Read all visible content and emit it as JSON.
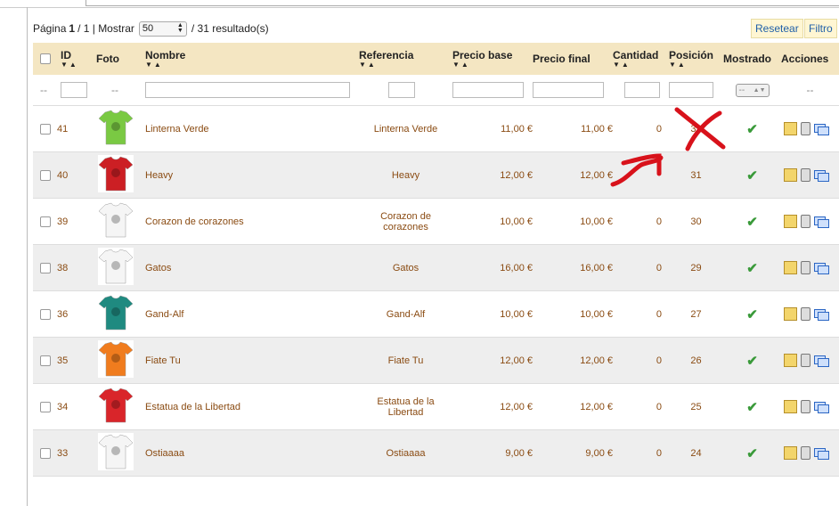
{
  "pager": {
    "page_label": "Página",
    "page_current": "1",
    "page_sep": "/ 1 | Mostrar",
    "per_page": "50",
    "results": "/ 31 resultado(s)"
  },
  "buttons": {
    "reset": "Resetear",
    "filter": "Filtro"
  },
  "columns": [
    "ID",
    "Foto",
    "Nombre",
    "Referencia",
    "Precio base",
    "Precio final",
    "Cantidad",
    "Posición",
    "Mostrado",
    "Acciones"
  ],
  "filter_row": {
    "dash": "--",
    "mostrado_value": "--"
  },
  "rows": [
    {
      "id": "41",
      "name": "Linterna Verde",
      "ref": "Linterna Verde",
      "base": "11,00 €",
      "final": "11,00 €",
      "qty": "0",
      "pos": "32",
      "shirt": "#7ac943",
      "shirt_icon": "lantern-shirt-icon"
    },
    {
      "id": "40",
      "name": "Heavy",
      "ref": "Heavy",
      "base": "12,00 €",
      "final": "12,00 €",
      "qty": "",
      "pos": "31",
      "shirt": "#cc1f24",
      "shirt_icon": "heavy-shirt-icon"
    },
    {
      "id": "39",
      "name": "Corazon de corazones",
      "ref": "Corazon de corazones",
      "base": "10,00 €",
      "final": "10,00 €",
      "qty": "0",
      "pos": "30",
      "shirt": "#f5f5f5",
      "shirt_icon": "heart-shirt-icon"
    },
    {
      "id": "38",
      "name": "Gatos",
      "ref": "Gatos",
      "base": "16,00 €",
      "final": "16,00 €",
      "qty": "0",
      "pos": "29",
      "shirt": "#f5f5f5",
      "shirt_icon": "cats-shirt-icon"
    },
    {
      "id": "36",
      "name": "Gand-Alf",
      "ref": "Gand-Alf",
      "base": "10,00 €",
      "final": "10,00 €",
      "qty": "0",
      "pos": "27",
      "shirt": "#1f8a80",
      "shirt_icon": "gandalf-shirt-icon"
    },
    {
      "id": "35",
      "name": "Fiate Tu",
      "ref": "Fiate Tu",
      "base": "12,00 €",
      "final": "12,00 €",
      "qty": "0",
      "pos": "26",
      "shirt": "#f07c1e",
      "shirt_icon": "fiate-shirt-icon"
    },
    {
      "id": "34",
      "name": "Estatua de la Libertad",
      "ref": "Estatua de la Libertad",
      "base": "12,00 €",
      "final": "12,00 €",
      "qty": "0",
      "pos": "25",
      "shirt": "#d9252a",
      "shirt_icon": "liberty-shirt-icon"
    },
    {
      "id": "33",
      "name": "Ostiaaaa",
      "ref": "Ostiaaaa",
      "base": "9,00 €",
      "final": "9,00 €",
      "qty": "0",
      "pos": "24",
      "shirt": "#f5f5f5",
      "shirt_icon": "ostia-shirt-icon"
    }
  ],
  "colors": {
    "header_bg": "#f4e6c2",
    "text_brown": "#8a4b12",
    "link_blue": "#1f5fa8",
    "annotation_red": "#d8121b"
  }
}
